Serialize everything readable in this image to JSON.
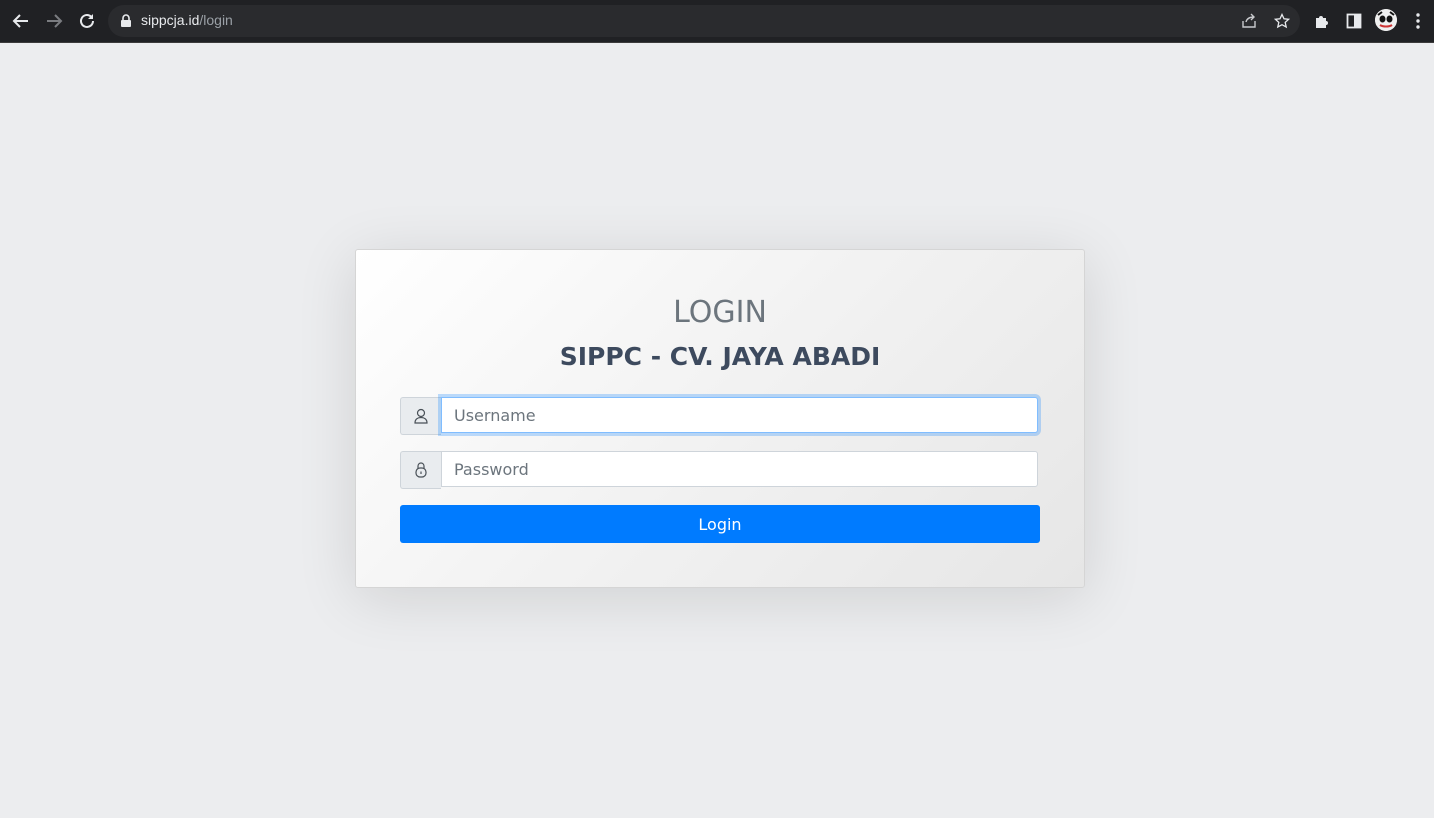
{
  "browser": {
    "url_domain": "sippcja.id",
    "url_path": "/login"
  },
  "login": {
    "title": "LOGIN",
    "subtitle": "SIPPC - CV. JAYA ABADI",
    "username_placeholder": "Username",
    "password_placeholder": "Password",
    "submit_label": "Login"
  },
  "colors": {
    "primary": "#007bff",
    "page_bg": "#ecedef",
    "focus_border": "#80bdff"
  },
  "icons": {
    "username": "user-icon",
    "password": "lock-icon"
  }
}
